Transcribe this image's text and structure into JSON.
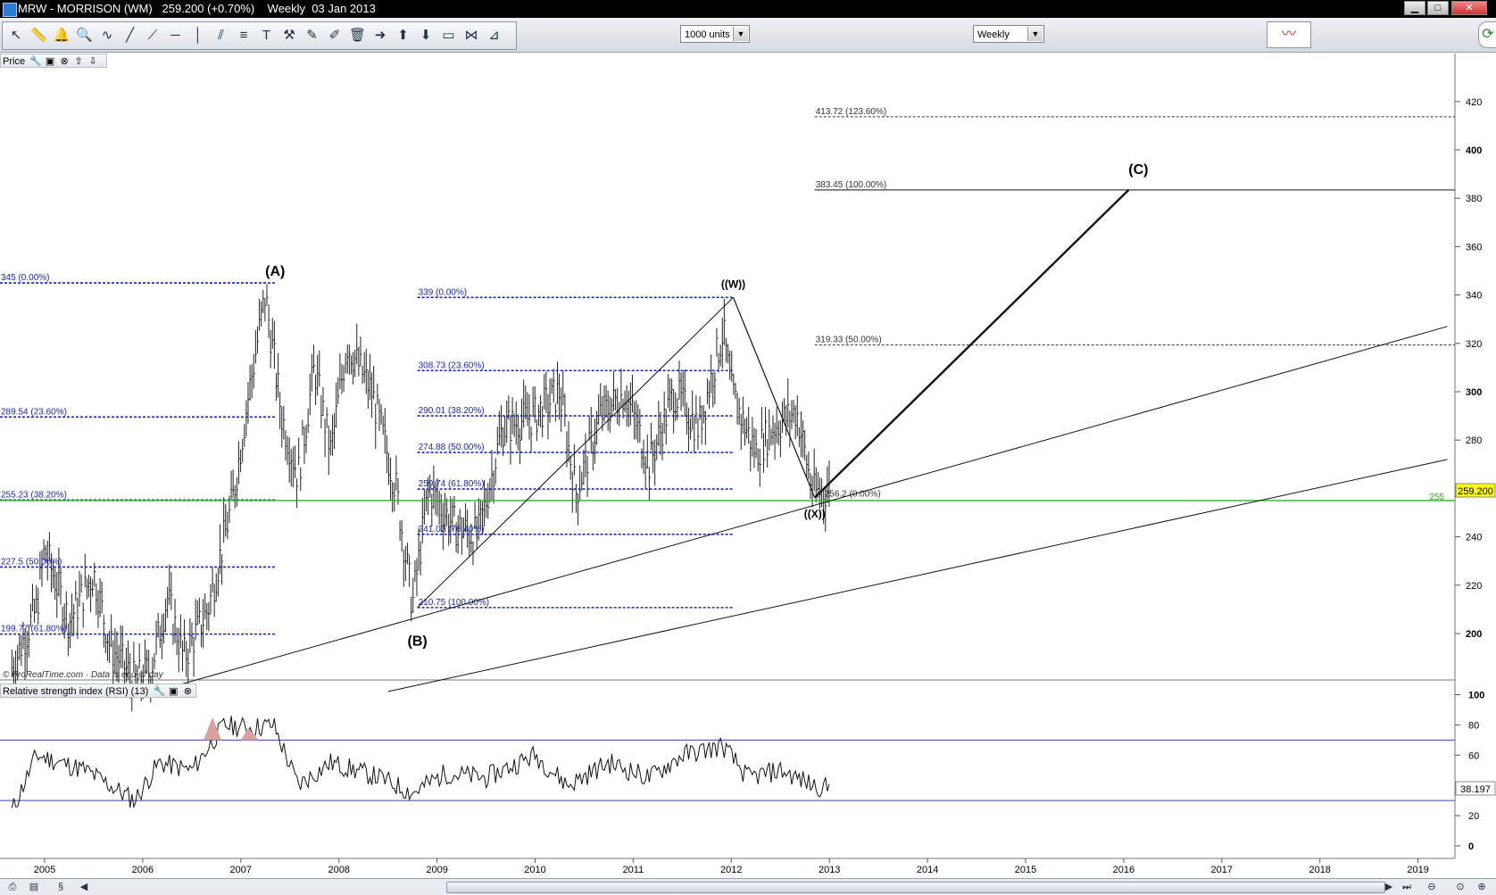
{
  "window": {
    "title": "MRW - MORRISON (WM)   259.200 (+0.70%)    Weekly  03 Jan 2013",
    "min_label": "▁",
    "max_label": "□",
    "close_label": "✕"
  },
  "toolbar": {
    "units_value": "1000 units",
    "period_value": "Weekly",
    "tools": [
      "pointer-icon",
      "ruler-icon",
      "alarm-icon",
      "zoom-icon",
      "indicator-icon",
      "trendline-icon",
      "line-icon",
      "horizontal-line-icon",
      "vertical-line-icon",
      "channel-icon",
      "fibonacci-icon",
      "text-icon",
      "tools-icon",
      "draw-icon",
      "pen-icon",
      "delete-icon",
      "arrow-right-icon",
      "arrow-up-icon",
      "arrow-down-icon",
      "rectangle-icon",
      "fib-retracement-icon",
      "fan-icon"
    ]
  },
  "price_panel": {
    "label": "Price",
    "watermark": "© ProRealTime.com · Data is end of day",
    "price_tag": "259.200",
    "level_255": "255",
    "y_ticks": [
      "420",
      "400",
      "380",
      "360",
      "340",
      "320",
      "300",
      "280",
      "260",
      "240",
      "220",
      "200"
    ],
    "y_ticks_bold": [
      "400",
      "300",
      "200"
    ]
  },
  "rsi_panel": {
    "label": "Relative strength index (RSI) (13)",
    "value_tag": "38.197",
    "y_ticks": [
      "100",
      "80",
      "60",
      "40",
      "20",
      "0"
    ],
    "overbought": 70,
    "oversold": 30
  },
  "x_axis": {
    "labels": [
      "2005",
      "2006",
      "2007",
      "2008",
      "2009",
      "2010",
      "2011",
      "2012",
      "2013",
      "2014",
      "2015",
      "2016",
      "2017",
      "2018",
      "2019"
    ]
  },
  "wave_labels": [
    "(A)",
    "(B)",
    "((W))",
    "((X))",
    "(C)"
  ],
  "fib_levels": {
    "set1": [
      "345 (0.00%)",
      "289.54 (23.60%)",
      "255.23 (38.20%)",
      "227.5 (50.00%)",
      "199.77 (61.80%)"
    ],
    "set2": [
      "339 (0.00%)",
      "308.73 (23.60%)",
      "290.01 (38.20%)",
      "274.88 (50.00%)",
      "259.74 (61.80%)",
      "241.02 (76.40%)",
      "210.75 (100.00%)"
    ],
    "set3": [
      "413.72 (123.60%)",
      "383.45 (100.00%)",
      "319.33 (50.00%)",
      "256.2 (0.00%)"
    ]
  },
  "colors": {
    "fib_blue": "#1a2aa8",
    "support_green": "#2bb02b",
    "rsi_line_blue": "#3a3ab0",
    "price_tag_bg": "#ffff00",
    "rsi_overbought_fill": "#d9a0a0"
  },
  "chart_data": {
    "type": "bar",
    "title": "MRW - MORRISON (WM) Weekly",
    "x_range": [
      "2004-08",
      "2019-03"
    ],
    "ylim": [
      175,
      432
    ],
    "series": [
      {
        "name": "MRW",
        "points": [
          [
            "2004-09",
            186
          ],
          [
            "2004-12",
            210
          ],
          [
            "2005-01",
            235
          ],
          [
            "2005-04",
            205
          ],
          [
            "2005-07",
            225
          ],
          [
            "2005-09",
            195
          ],
          [
            "2005-12",
            180
          ],
          [
            "2006-02",
            185
          ],
          [
            "2006-04",
            215
          ],
          [
            "2006-06",
            190
          ],
          [
            "2006-09",
            210
          ],
          [
            "2006-12",
            255
          ],
          [
            "2007-02",
            300
          ],
          [
            "2007-04",
            340
          ],
          [
            "2007-06",
            290
          ],
          [
            "2007-08",
            265
          ],
          [
            "2007-10",
            310
          ],
          [
            "2007-12",
            275
          ],
          [
            "2008-02",
            320
          ],
          [
            "2008-05",
            300
          ],
          [
            "2008-08",
            260
          ],
          [
            "2008-10",
            212
          ],
          [
            "2008-12",
            260
          ],
          [
            "2009-03",
            245
          ],
          [
            "2009-06",
            240
          ],
          [
            "2009-09",
            285
          ],
          [
            "2010-01",
            290
          ],
          [
            "2010-04",
            300
          ],
          [
            "2010-06",
            258
          ],
          [
            "2010-09",
            290
          ],
          [
            "2010-12",
            300
          ],
          [
            "2011-03",
            270
          ],
          [
            "2011-06",
            300
          ],
          [
            "2011-09",
            285
          ],
          [
            "2011-12",
            325
          ],
          [
            "2012-01",
            300
          ],
          [
            "2012-04",
            275
          ],
          [
            "2012-06",
            285
          ],
          [
            "2012-09",
            292
          ],
          [
            "2012-11",
            258
          ],
          [
            "2013-01",
            259.2
          ]
        ]
      }
    ],
    "rsi": {
      "name": "RSI (13)",
      "points": [
        [
          "2004-09",
          23
        ],
        [
          "2004-12",
          60
        ],
        [
          "2005-06",
          50
        ],
        [
          "2005-12",
          30
        ],
        [
          "2006-03",
          55
        ],
        [
          "2006-07",
          50
        ],
        [
          "2006-11",
          80
        ],
        [
          "2007-02",
          78
        ],
        [
          "2007-05",
          80
        ],
        [
          "2007-08",
          40
        ],
        [
          "2007-12",
          55
        ],
        [
          "2008-06",
          45
        ],
        [
          "2008-10",
          35
        ],
        [
          "2009-02",
          48
        ],
        [
          "2009-07",
          45
        ],
        [
          "2010-01",
          60
        ],
        [
          "2010-05",
          40
        ],
        [
          "2010-10",
          55
        ],
        [
          "2011-03",
          45
        ],
        [
          "2011-07",
          60
        ],
        [
          "2011-12",
          66
        ],
        [
          "2012-03",
          45
        ],
        [
          "2012-07",
          50
        ],
        [
          "2012-11",
          40
        ],
        [
          "2013-01",
          38.197
        ]
      ]
    },
    "annotations": [
      "(A)",
      "(B)",
      "((W))",
      "((X))",
      "(C)"
    ]
  }
}
